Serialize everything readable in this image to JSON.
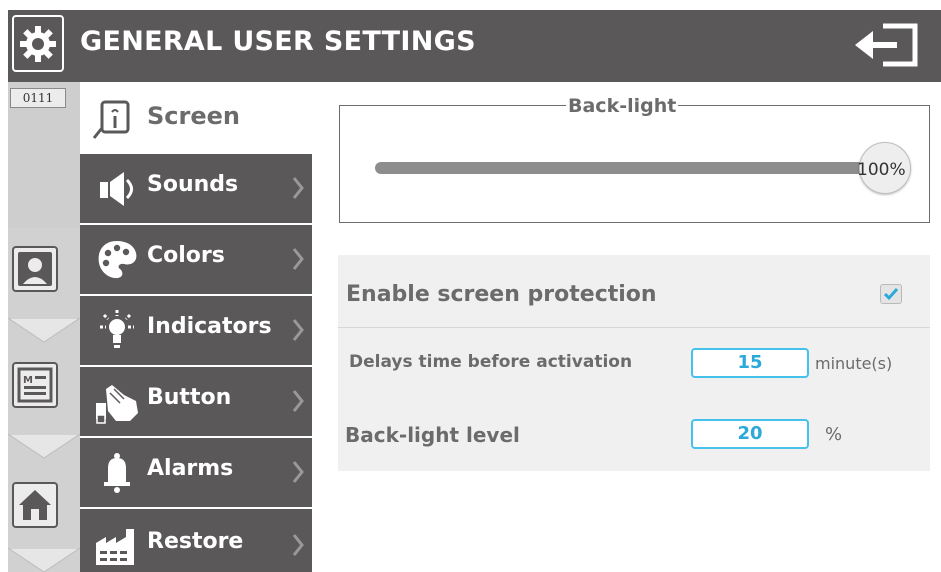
{
  "header": {
    "title": "GENERAL USER SETTINGS"
  },
  "left_strip": {
    "code": "0111"
  },
  "menu": {
    "selected_label": "Screen",
    "items": [
      {
        "label": "Sounds",
        "icon": "speaker-icon"
      },
      {
        "label": "Colors",
        "icon": "palette-icon"
      },
      {
        "label": "Indicators",
        "icon": "lightbulb-icon"
      },
      {
        "label": "Button",
        "icon": "hand-press-icon"
      },
      {
        "label": "Alarms",
        "icon": "bell-icon"
      },
      {
        "label": "Restore",
        "icon": "factory-icon"
      }
    ]
  },
  "backlight": {
    "title": "Back-light",
    "value_label": "100%",
    "level_percent": 100
  },
  "protection": {
    "label": "Enable screen protection",
    "enabled": true,
    "delay_label": "Delays time before activation",
    "delay_value": "15",
    "delay_unit": "minute(s)",
    "level_label": "Back-light level",
    "level_value": "20",
    "level_unit": "%"
  },
  "colors": {
    "header": "#5b585a",
    "menu": "#5b585a",
    "accent": "#46c1ec",
    "text_gray": "#6b6b6b"
  }
}
